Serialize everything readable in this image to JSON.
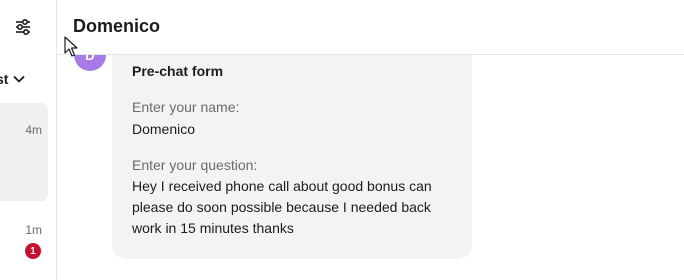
{
  "sidebar": {
    "sort_label": "st",
    "conversations": [
      {
        "time": "4m"
      },
      {
        "time": "1m",
        "unread_count": "1"
      }
    ]
  },
  "header": {
    "title": "Domenico"
  },
  "message": {
    "avatar_initial": "D",
    "form_title": "Pre-chat form",
    "name_label": "Enter your name:",
    "name_value": "Domenico",
    "question_label": "Enter your question:",
    "question_value": "Hey I received phone call about good bonus can please do soon possible because I needed back work in 15 minutes thanks"
  },
  "colors": {
    "avatar": "#a67be8",
    "badge": "#c8102e",
    "bubble": "#f3f3f3",
    "active_item": "#f0f0f0"
  },
  "icons": {
    "filter": "sliders-icon",
    "sort": "chevron-down-icon",
    "cursor": "mouse-pointer-icon"
  }
}
